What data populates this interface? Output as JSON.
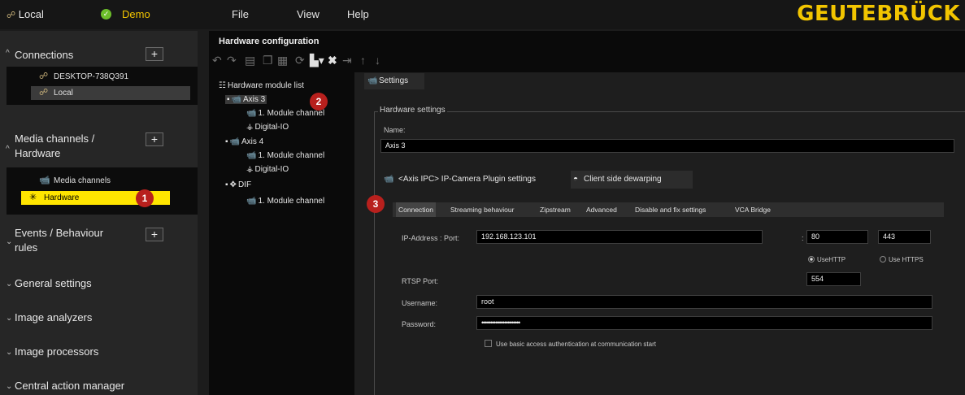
{
  "topbar": {
    "local": "Local",
    "demo": "Demo",
    "menu": [
      "File",
      "View",
      "Help"
    ],
    "logo": "GEUTEBRÜCK"
  },
  "sidebar": {
    "connections": {
      "title": "Connections",
      "items": [
        "DESKTOP-738Q391",
        "Local"
      ]
    },
    "media": {
      "title_line1": "Media channels /",
      "title_line2": "Hardware",
      "items": [
        "Media channels",
        "Hardware"
      ]
    },
    "events": {
      "title_line1": "Events / Behaviour",
      "title_line2": "rules"
    },
    "general": "General settings",
    "analyzers": "Image analyzers",
    "processors": "Image processors",
    "central": "Central action manager"
  },
  "badges": [
    "1",
    "2",
    "3"
  ],
  "hw": {
    "title": "Hardware configuration",
    "tree": {
      "root": "Hardware module list",
      "axis3": "Axis 3",
      "axis3_children": [
        "1. Module channel",
        "Digital-IO"
      ],
      "axis4": "Axis 4",
      "axis4_children": [
        "1. Module channel",
        "Digital-IO"
      ],
      "dif": "DIF",
      "dif_children": [
        "1. Module channel"
      ]
    }
  },
  "settings": {
    "tab": "Settings",
    "legend": "Hardware settings",
    "name_label": "Name:",
    "name_value": "Axis 3",
    "plugin_tab": "<Axis IPC> IP-Camera Plugin settings",
    "dewarp_tab": "Client side dewarping",
    "subtabs": [
      "Connection",
      "Streaming behaviour",
      "Zipstream",
      "Advanced",
      "Disable and fix settings",
      "VCA Bridge"
    ],
    "ip_label": "IP-Address : Port:",
    "ip_value": "192.168.123.101",
    "colon": ":",
    "port_http": "80",
    "port_https": "443",
    "use_http": "UseHTTP",
    "use_https": "Use HTTPS",
    "rtsp_label": "RTSP Port:",
    "rtsp_value": "554",
    "user_label": "Username:",
    "user_value": "root",
    "pass_label": "Password:",
    "pass_value": "••••••••••••••••••••••",
    "basic_auth": "Use basic access authentication at communication start"
  }
}
